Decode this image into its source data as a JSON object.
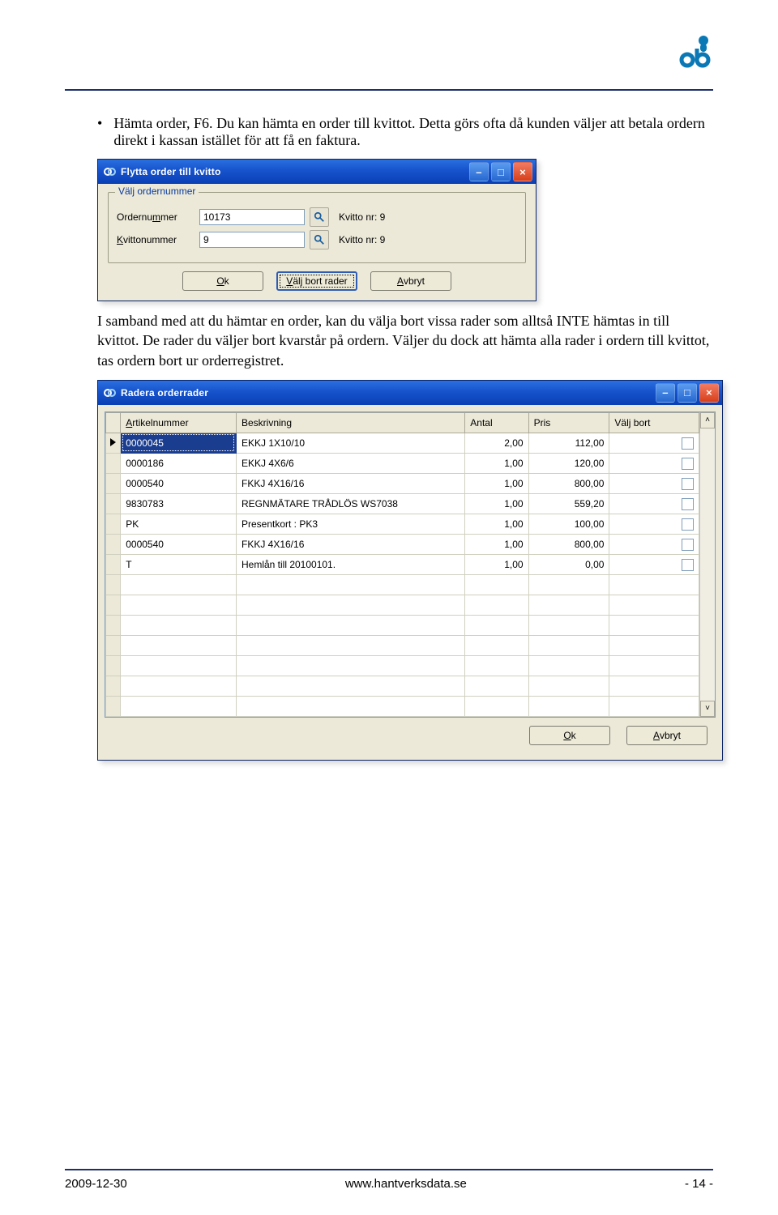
{
  "bullet": {
    "title": "Hämta order, F6.",
    "text": "Du kan hämta en order till kvittot. Detta görs ofta då kunden väljer att betala ordern direkt i kassan istället för att få en faktura."
  },
  "win1": {
    "title": "Flytta order till kvitto",
    "groupbox_title": "Välj ordernummer",
    "f1_label_pre": "Ordernu",
    "f1_label_u": "m",
    "f1_label_post": "mer",
    "f1_value": "10173",
    "f1_after": "Kvitto nr: 9",
    "f2_label_u": "K",
    "f2_label_post": "vittonummer",
    "f2_value": "9",
    "f2_after": "Kvitto nr: 9",
    "btn_ok_u": "O",
    "btn_ok_rest": "k",
    "btn_valj_u": "V",
    "btn_valj_rest": "älj bort rader",
    "btn_avbryt_u": "A",
    "btn_avbryt_rest": "vbryt"
  },
  "para2": "I samband med att du hämtar en order, kan du välja bort vissa rader som alltså INTE hämtas in till kvittot. De rader du väljer bort kvarstår på ordern. Väljer du dock att hämta alla rader i ordern till kvittot, tas ordern bort ur orderregistret.",
  "win2": {
    "title": "Radera orderrader",
    "headers": {
      "art": "Artikelnummer",
      "desc": "Beskrivning",
      "antal": "Antal",
      "pris": "Pris",
      "check": "Välj bort"
    },
    "rows": [
      {
        "a": "0000045",
        "d": "EKKJ 1X10/10",
        "q": "2,00",
        "p": "112,00"
      },
      {
        "a": "0000186",
        "d": "EKKJ 4X6/6",
        "q": "1,00",
        "p": "120,00"
      },
      {
        "a": "0000540",
        "d": "FKKJ 4X16/16",
        "q": "1,00",
        "p": "800,00"
      },
      {
        "a": "9830783",
        "d": "REGNMÄTARE TRÅDLÖS WS7038",
        "q": "1,00",
        "p": "559,20"
      },
      {
        "a": "PK",
        "d": "Presentkort : PK3",
        "q": "1,00",
        "p": "100,00"
      },
      {
        "a": "0000540",
        "d": "FKKJ 4X16/16",
        "q": "1,00",
        "p": "800,00"
      },
      {
        "a": "T",
        "d": "Hemlån till 20100101.",
        "q": "1,00",
        "p": "0,00"
      }
    ],
    "btn_ok_u": "O",
    "btn_ok_rest": "k",
    "btn_avbryt_u": "A",
    "btn_avbryt_rest": "vbryt",
    "scroll_up": "˄",
    "scroll_down": "˅"
  },
  "footer": {
    "date": "2009-12-30",
    "url": "www.hantverksdata.se",
    "page": "- 14 -"
  },
  "title_btn": {
    "min": "–",
    "max": "□",
    "close": "×"
  }
}
